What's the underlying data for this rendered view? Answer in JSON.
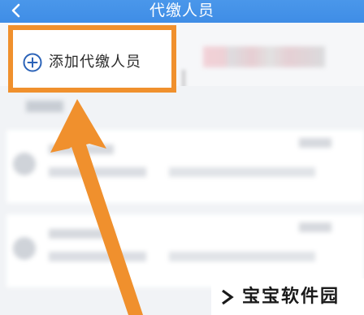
{
  "header": {
    "title": "代缴人员",
    "back_icon": "chevron-left-icon",
    "background_color": "#4a97ea"
  },
  "add_button": {
    "label": "添加代缴人员",
    "icon": "plus-circle-icon",
    "icon_color": "#2b63b8"
  },
  "annotation": {
    "highlight_color": "#f0902d",
    "arrow_color": "#f0902d"
  },
  "watermark": {
    "text": "宝宝软件园",
    "icon": "watermark-logo-icon"
  }
}
